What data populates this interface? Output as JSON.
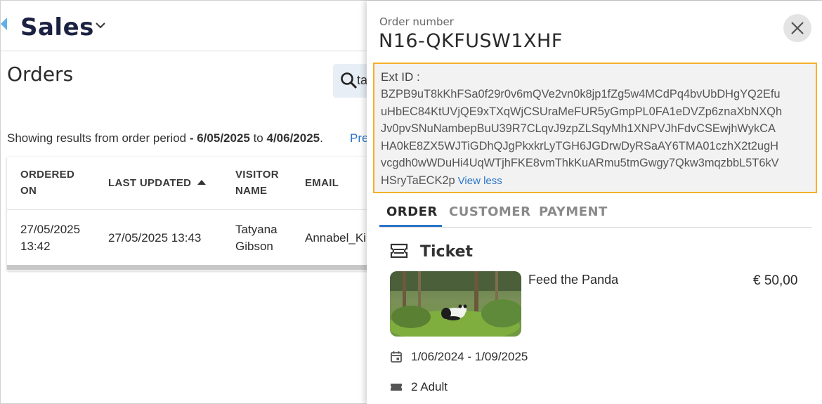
{
  "app": {
    "title": "Sales",
    "page_title": "Orders",
    "search_value": "ta"
  },
  "results": {
    "prefix": "Showing results from order period ",
    "from": "- 6/05/2025",
    "middle": " to ",
    "to": "4/06/2025",
    "suffix": ".",
    "prev_link": "Pre"
  },
  "table": {
    "headers": {
      "ordered_on": [
        "ORDERED",
        "ON"
      ],
      "last_updated": "LAST UPDATED",
      "visitor_name": [
        "VISITOR",
        "NAME"
      ],
      "email": "EMAIL"
    },
    "rows": [
      {
        "ordered_on": [
          "27/05/2025",
          "13:42"
        ],
        "last_updated": "27/05/2025 13:43",
        "visitor_name": [
          "Tatyana",
          "Gibson"
        ],
        "email": "Annabel_Ki"
      }
    ]
  },
  "panel": {
    "order_label": "Order number",
    "order_number": "N16-QKFUSW1XHF",
    "ext_label": "Ext ID :",
    "ext_lines": [
      "BZPB9uT8kKhFSa0f29r0v6mQVe2vn0k8jp1fZg5w4MCdPq4bvUbDHgYQ2Efu",
      "uHbEC84KtUVjQE9xTXqWjCSUraMeFUR5yGmpPL0FA1eDVZp6znaXbNXQh",
      "Jv0pvSNuNambepBuU39R7CLqvJ9zpZLSqyMh1XNPVJhFdvCSEwjhWykCA",
      "HA0kE8ZX5WJTiGDhQJgPkxkrLyTGH6JGDrwDyRSaAY6TMA01czhX2t2ugH",
      "vcgdh0wWDuHi4UqWTjhFKE8vmThkKuARmu5tmGwgy7Qkw3mqzbbL5T6kV",
      "HSryTaECK2p"
    ],
    "view_less": "View less",
    "tabs": [
      "ORDER",
      "CUSTOMER",
      "PAYMENT"
    ],
    "section_title": "Ticket",
    "product_name": "Feed the Panda",
    "product_price": "€ 50,00",
    "date_range": "1/06/2024 - 1/09/2025",
    "tickets": "2 Adult"
  },
  "colors": {
    "accent": "#2a74c8",
    "highlight_border": "#f4b128",
    "brand_title": "#1b2140"
  },
  "icons": [
    "back-arrow-icon",
    "chevron-down-icon",
    "search-icon",
    "sort-asc-icon",
    "close-icon",
    "ticket-icon",
    "calendar-icon",
    "ticket-small-icon"
  ]
}
